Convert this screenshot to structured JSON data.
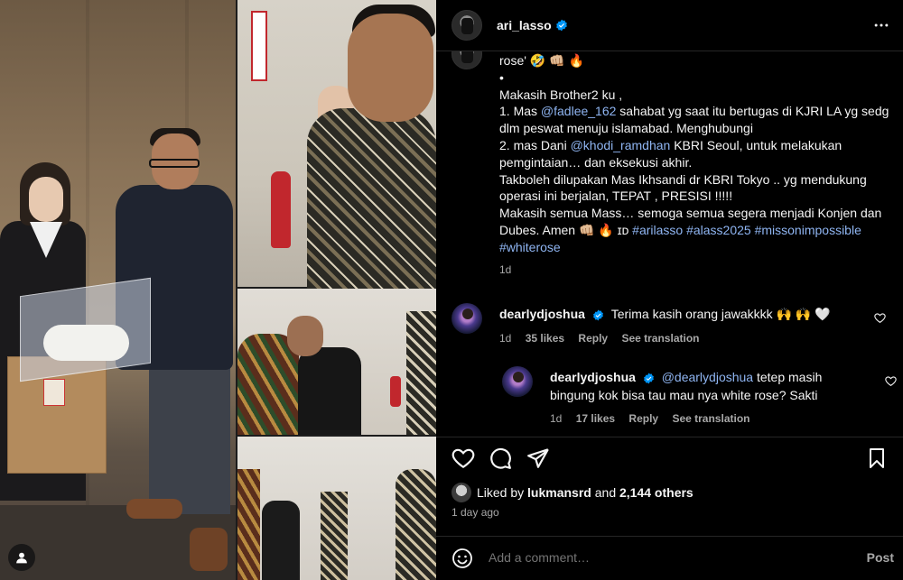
{
  "post": {
    "author": "ari_lasso",
    "caption_lines": [
      "rose' 🤣 👊🏼 🔥",
      "•",
      "Makasih Brother2 ku ,",
      [
        "1. Mas ",
        "@fadlee_162",
        " sahabat yg saat itu bertugas di KJRI LA yg sedg"
      ],
      "dlm peswat menuju islamabad. Menghubungi",
      [
        "2. mas Dani ",
        "@khodi_ramdhan",
        " KBRI Seoul, untuk melakukan"
      ],
      "pemgintaian… dan eksekusi akhir.",
      "Takboleh dilupakan Mas Ikhsandi dr KBRI Tokyo .. yg mendukung",
      "operasi ini berjalan, TEPAT , PRESISI !!!!!",
      "Makasih semua Mass… semoga semua segera menjadi Konjen dan",
      [
        "Dubes. Amen 👊🏼 🔥 ɪᴅ ",
        "#arilasso #alass2025 #missonimpossible"
      ],
      [
        "",
        "#whiterose"
      ]
    ],
    "caption_time": "1d",
    "likes_prefix": "Liked by",
    "liked_by_user": "lukmansrd",
    "likes_connector": "and",
    "likes_others": "2,144 others",
    "post_time": "1 day ago"
  },
  "comments": [
    {
      "username": "dearlydjoshua",
      "text": "Terima kasih orang jawakkkk 🙌 🙌 🤍",
      "time": "1d",
      "likes": "35 likes",
      "reply": "Reply",
      "translate": "See translation"
    },
    {
      "username": "dearlydjoshua",
      "mention": "@dearlydjoshua",
      "text_line1": " tetep masih",
      "text_line2": "bingung kok bisa tau mau nya white rose? Sakti",
      "time": "1d",
      "likes": "17 likes",
      "reply": "Reply",
      "translate": "See translation"
    }
  ],
  "composer": {
    "placeholder": "Add a comment…",
    "post_label": "Post"
  },
  "icons": [
    "more-options-icon",
    "verified-badge-icon",
    "heart-icon",
    "comment-icon",
    "share-icon",
    "bookmark-icon",
    "emoji-icon",
    "user-tag-icon"
  ],
  "colors": {
    "link": "#8fb5f2",
    "verified": "#0095f6",
    "background": "#000000"
  }
}
